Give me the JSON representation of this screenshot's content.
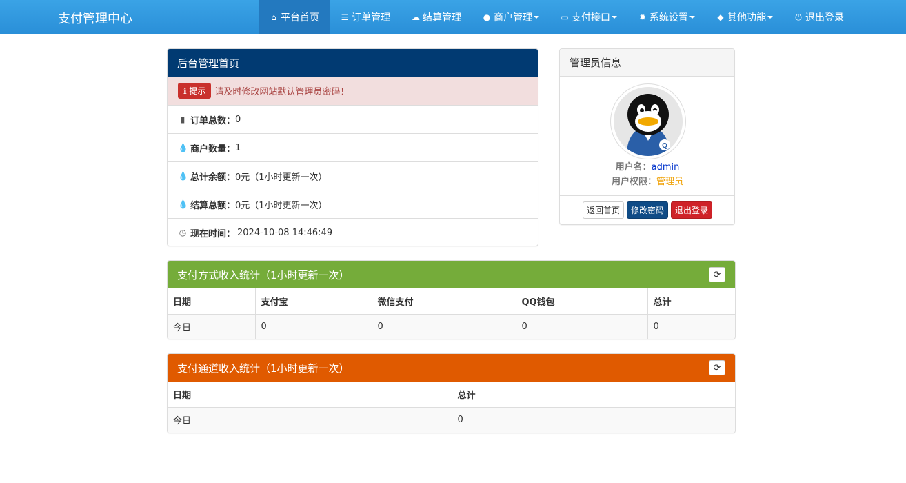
{
  "brand": "支付管理中心",
  "nav": [
    {
      "icon": "home-icon",
      "label": "平台首页",
      "active": true,
      "dropdown": false
    },
    {
      "icon": "list-icon",
      "label": "订单管理",
      "active": false,
      "dropdown": false
    },
    {
      "icon": "cloud-icon",
      "label": "结算管理",
      "active": false,
      "dropdown": false
    },
    {
      "icon": "user-icon",
      "label": "商户管理",
      "active": false,
      "dropdown": true
    },
    {
      "icon": "credit-card-icon",
      "label": "支付接口",
      "active": false,
      "dropdown": true
    },
    {
      "icon": "gear-icon",
      "label": "系统设置",
      "active": false,
      "dropdown": true
    },
    {
      "icon": "cube-icon",
      "label": "其他功能",
      "active": false,
      "dropdown": true
    },
    {
      "icon": "power-icon",
      "label": "退出登录",
      "active": false,
      "dropdown": false
    }
  ],
  "home_panel": {
    "title": "后台管理首页",
    "alert_badge": "提示",
    "alert_text": "请及时修改网站默认管理员密码！",
    "rows": [
      {
        "icon": "bar-chart-icon",
        "label": "订单总数：",
        "value": "0"
      },
      {
        "icon": "drop-icon",
        "label": "商户数量：",
        "value": "1"
      },
      {
        "icon": "drop-icon",
        "label": "总计余额：",
        "value": "0元（1小时更新一次）"
      },
      {
        "icon": "drop-icon",
        "label": "结算总额：",
        "value": "0元（1小时更新一次）"
      },
      {
        "icon": "clock-icon",
        "label": "现在时间：",
        "value": "2024-10-08 14:46:49"
      }
    ]
  },
  "admin_panel": {
    "title": "管理员信息",
    "username_label": "用户名：",
    "username": "admin",
    "role_label": "用户权限：",
    "role": "管理员",
    "btn_home": "返回首页",
    "btn_password": "修改密码",
    "btn_logout": "退出登录"
  },
  "method_stats": {
    "title": "支付方式收入统计（1小时更新一次）",
    "columns": [
      "日期",
      "支付宝",
      "微信支付",
      "QQ钱包",
      "总计"
    ],
    "rows": [
      [
        "今日",
        "0",
        "0",
        "0",
        "0"
      ]
    ]
  },
  "channel_stats": {
    "title": "支付通道收入统计（1小时更新一次）",
    "columns": [
      "日期",
      "总计"
    ],
    "rows": [
      [
        "今日",
        "0"
      ]
    ]
  },
  "colors": {
    "navbar": "#2a8fd8",
    "home_heading": "#013a72",
    "method_heading": "#75ac3a",
    "channel_heading": "#e05a00"
  }
}
